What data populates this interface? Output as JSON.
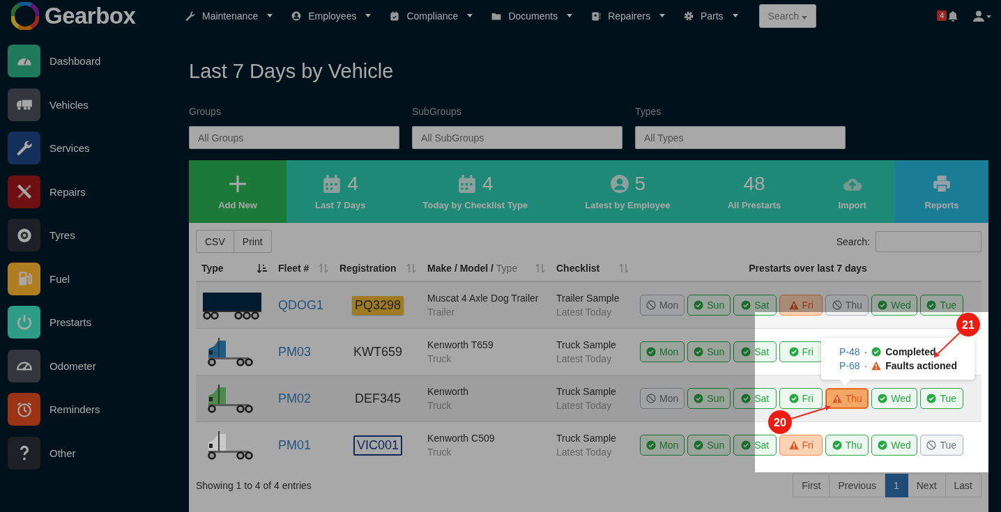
{
  "brand": "Gearbox",
  "nav": [
    {
      "label": "Maintenance"
    },
    {
      "label": "Employees"
    },
    {
      "label": "Compliance"
    },
    {
      "label": "Documents"
    },
    {
      "label": "Repairers"
    },
    {
      "label": "Parts"
    }
  ],
  "search_button": "Search",
  "notifications": {
    "count": "4"
  },
  "sidebar": {
    "items": [
      {
        "label": "Dashboard",
        "color": "#1f7a5b"
      },
      {
        "label": "Vehicles",
        "color": "#33363c"
      },
      {
        "label": "Services",
        "color": "#12305a"
      },
      {
        "label": "Repairs",
        "color": "#6e1012"
      },
      {
        "label": "Tyres",
        "color": "#1c1f26"
      },
      {
        "label": "Fuel",
        "color": "#b07d20"
      },
      {
        "label": "Prestarts",
        "color": "#2c9c87"
      },
      {
        "label": "Odometer",
        "color": "#33363c"
      },
      {
        "label": "Reminders",
        "color": "#9a3214"
      },
      {
        "label": "Other",
        "color": "#1c1f26"
      }
    ]
  },
  "title": "Last 7 Days by Vehicle",
  "filters": [
    {
      "label": "Groups",
      "value": "All Groups"
    },
    {
      "label": "SubGroups",
      "value": "All SubGroups"
    },
    {
      "label": "Types",
      "value": "All Types"
    }
  ],
  "tiles": [
    {
      "kind": "add",
      "label": "Add New"
    },
    {
      "kind": "calendar",
      "count": "4",
      "label": "Last 7 Days"
    },
    {
      "kind": "calendar",
      "count": "4",
      "label": "Today by Checklist Type"
    },
    {
      "kind": "person",
      "count": "5",
      "label": "Latest by Employee"
    },
    {
      "kind": "number",
      "count": "48",
      "label": "All Prestarts"
    },
    {
      "kind": "upload",
      "label": "Import"
    },
    {
      "kind": "print",
      "label": "Reports"
    }
  ],
  "export_buttons": [
    "CSV",
    "Print"
  ],
  "table_search": {
    "label": "Search:"
  },
  "table": {
    "columns": [
      {
        "label": "Type",
        "kind": "sorted"
      },
      {
        "label": "Fleet #",
        "kind": "sortable"
      },
      {
        "label": "Registration",
        "kind": "sortable"
      },
      {
        "label": "Make / Model /",
        "sublabel": "Type",
        "kind": "sortable"
      },
      {
        "label": "Checklist",
        "kind": "sortable"
      },
      {
        "label": "Prestarts over last 7 days",
        "kind": "plain"
      }
    ],
    "rows": [
      {
        "vehicle": {
          "kind": "trailer",
          "color": "#001a2e"
        },
        "fleet": "QDOG1",
        "registration": {
          "kind": "yellow",
          "text": "PQ3298"
        },
        "model": "Muscat 4 Axle Dog Trailer",
        "type": "Trailer",
        "checklist": "Trailer Sample",
        "latest": "Latest Today",
        "days": [
          {
            "label": "Mon",
            "kind": "missed",
            "active": false
          },
          {
            "label": "Sun",
            "kind": "ok",
            "active": false
          },
          {
            "label": "Sat",
            "kind": "ok",
            "active": false
          },
          {
            "label": "Fri",
            "kind": "warn",
            "active": false
          },
          {
            "label": "Thu",
            "kind": "missed",
            "active": false
          },
          {
            "label": "Wed",
            "kind": "ok",
            "active": false
          },
          {
            "label": "Tue",
            "kind": "ok",
            "active": false
          }
        ]
      },
      {
        "vehicle": {
          "kind": "truck",
          "color": "#1c5d85"
        },
        "fleet": "PM03",
        "registration": {
          "kind": "plain",
          "text": "KWT659"
        },
        "model": "Kenworth T659",
        "type": "Truck",
        "checklist": "Truck Sample",
        "latest": "Latest Today",
        "days": [
          {
            "label": "Mon",
            "kind": "ok",
            "active": false
          },
          {
            "label": "Sun",
            "kind": "ok",
            "active": false
          },
          {
            "label": "Sat",
            "kind": "ok",
            "active": false
          },
          {
            "label": "Fri",
            "kind": "ok",
            "active": false
          }
        ]
      },
      {
        "vehicle": {
          "kind": "truck",
          "color": "#4a8a4a"
        },
        "fleet": "PM02",
        "registration": {
          "kind": "plain",
          "text": "DEF345"
        },
        "model": "Kenworth",
        "type": "Truck",
        "checklist": "Truck Sample",
        "latest": "Latest Today",
        "days": [
          {
            "label": "Mon",
            "kind": "missed",
            "active": false
          },
          {
            "label": "Sun",
            "kind": "ok",
            "active": false
          },
          {
            "label": "Sat",
            "kind": "ok",
            "active": false
          },
          {
            "label": "Fri",
            "kind": "ok",
            "active": false
          },
          {
            "label": "Thu",
            "kind": "warn",
            "active": true
          },
          {
            "label": "Wed",
            "kind": "ok",
            "active": false
          },
          {
            "label": "Tue",
            "kind": "ok",
            "active": false
          }
        ]
      },
      {
        "vehicle": {
          "kind": "truck",
          "color": "#c9c9c9"
        },
        "fleet": "PM01",
        "registration": {
          "kind": "outline",
          "text": "VIC001"
        },
        "model": "Kenworth C509",
        "type": "Truck",
        "checklist": "Truck Sample",
        "latest": "Latest Today",
        "days": [
          {
            "label": "Mon",
            "kind": "ok",
            "active": false
          },
          {
            "label": "Sun",
            "kind": "ok",
            "active": false
          },
          {
            "label": "Sat",
            "kind": "ok",
            "active": false
          },
          {
            "label": "Fri",
            "kind": "warn",
            "active": false
          },
          {
            "label": "Thu",
            "kind": "ok",
            "active": false
          },
          {
            "label": "Wed",
            "kind": "ok",
            "active": false
          },
          {
            "label": "Tue",
            "kind": "missed",
            "active": false
          }
        ]
      }
    ]
  },
  "tooltip": {
    "lines": [
      {
        "link": "P-48",
        "separator": "·",
        "kind": "ok",
        "text": "Completed"
      },
      {
        "link": "P-68",
        "separator": "·",
        "kind": "warn",
        "text": "Faults actioned"
      }
    ]
  },
  "info": "Showing 1 to 4 of 4 entries",
  "pagination": [
    {
      "label": "First",
      "selected": false
    },
    {
      "label": "Previous",
      "selected": false
    },
    {
      "label": "1",
      "selected": true
    },
    {
      "label": "Next",
      "selected": false
    },
    {
      "label": "Last",
      "selected": false
    }
  ],
  "callouts": [
    {
      "label": "21"
    },
    {
      "label": "20"
    }
  ]
}
